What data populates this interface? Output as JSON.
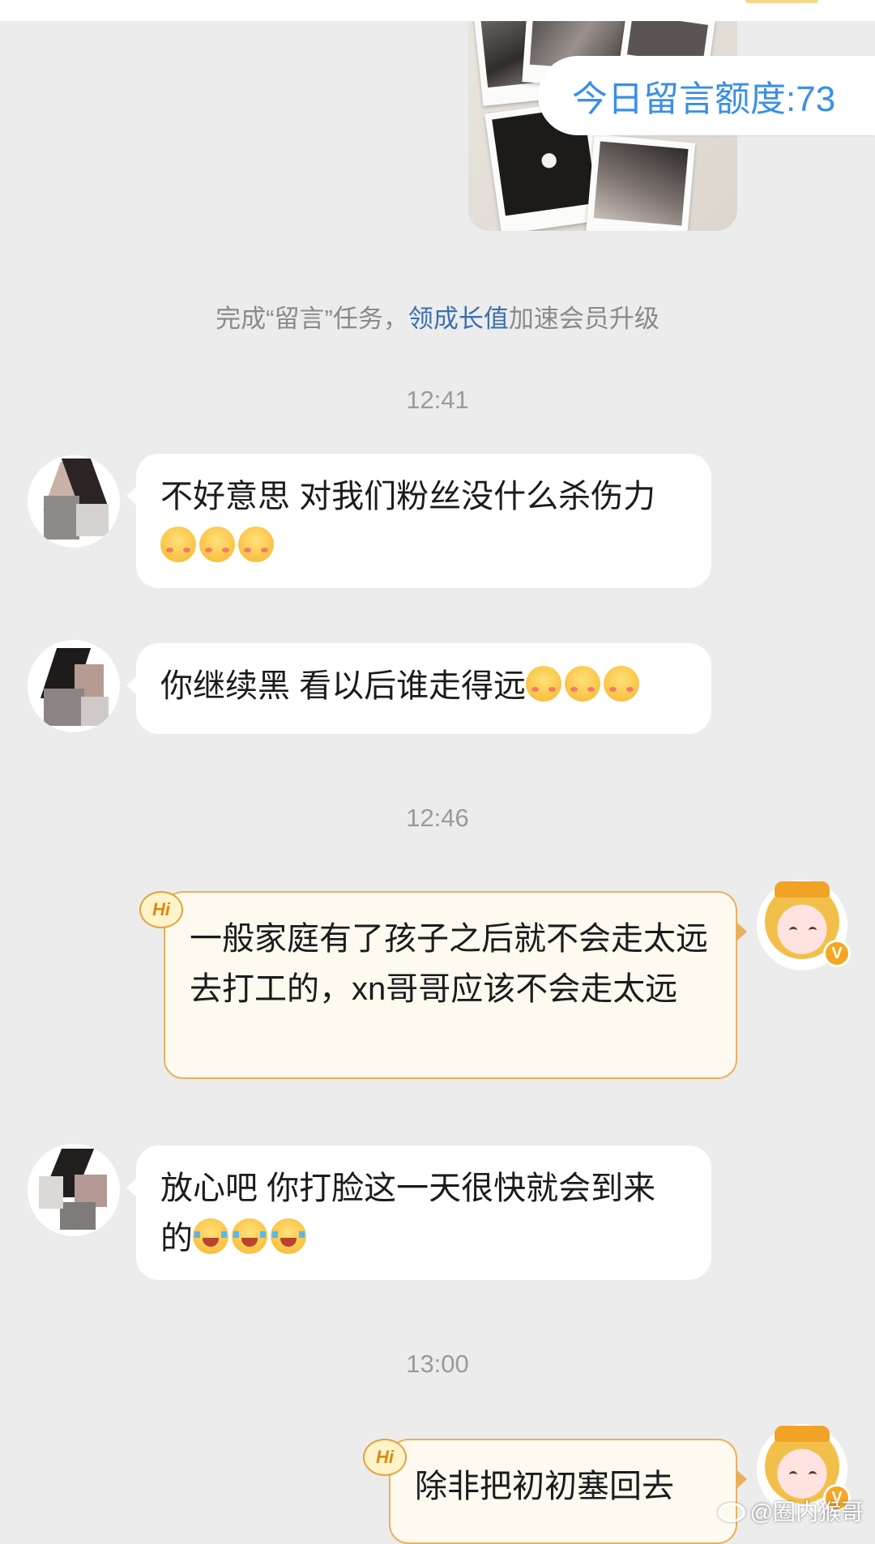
{
  "quota": {
    "label": "今日留言额度:73"
  },
  "system_note": {
    "prefix": "完成“留言”任务，",
    "link": "领成长值",
    "suffix": "加速会员升级"
  },
  "timestamps": [
    "12:41",
    "12:46",
    "13:00"
  ],
  "messages": [
    {
      "side": "left",
      "text": "不好意思 对我们粉丝没什么杀伤力",
      "emoji": "blush-smile-emoji"
    },
    {
      "side": "left",
      "text": "你继续黑 看以后谁走得远",
      "emoji": "blush-smile-emoji"
    },
    {
      "side": "right",
      "badge": "Hi",
      "text": "一般家庭有了孩子之后就不会走太远去打工的，xn哥哥应该不会走太远"
    },
    {
      "side": "left",
      "text": "放心吧 你打脸这一天很快就会到来的",
      "emoji": "tears-of-joy-emoji"
    },
    {
      "side": "right",
      "badge": "Hi",
      "text": "除非把初初塞回去"
    }
  ],
  "verified_badge": "V",
  "watermark": {
    "text": "@圈内猴哥",
    "icon": "weibo-icon"
  },
  "colors": {
    "background": "#ececec",
    "link": "#3d6fb0",
    "quota_text": "#3b8fe6",
    "own_bubble_border": "#e9b15c",
    "own_bubble_fill": "#fffaf0"
  }
}
